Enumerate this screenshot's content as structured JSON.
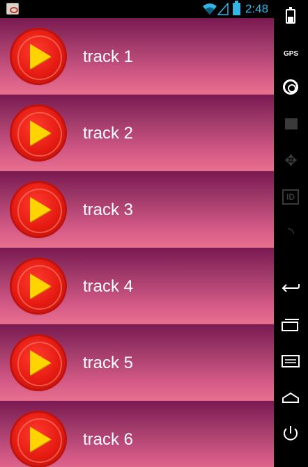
{
  "status_bar": {
    "time": "2:48",
    "icons": [
      "notification-icon",
      "wifi-icon",
      "signal-icon",
      "battery-icon"
    ],
    "accent_color": "#33b5e5"
  },
  "tracks": [
    {
      "label": "track 1"
    },
    {
      "label": "track 2"
    },
    {
      "label": "track 3"
    },
    {
      "label": "track 4"
    },
    {
      "label": "track 5"
    },
    {
      "label": "track 6"
    }
  ],
  "side_bar": {
    "gps_label": "GPS",
    "id_label": "ID",
    "icons": [
      "battery-icon",
      "gps-icon",
      "webcam-icon",
      "clapper-icon",
      "dpad-icon",
      "id-icon",
      "rss-icon",
      "back-icon",
      "recent-apps-icon",
      "menu-icon",
      "home-icon",
      "power-icon"
    ]
  },
  "colors": {
    "row_top": "#7a1a52",
    "row_bottom": "#e8708f",
    "play_button": "#e51b12",
    "play_triangle": "#ffd400"
  }
}
